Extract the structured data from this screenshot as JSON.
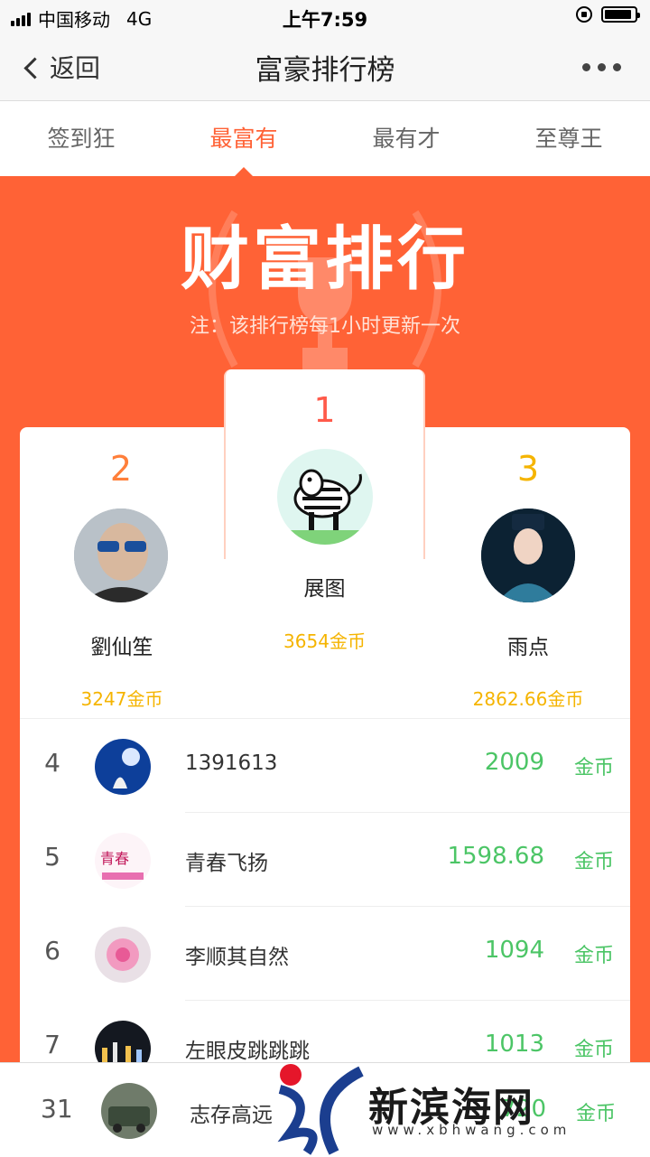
{
  "status": {
    "carrier": "中国移动",
    "network": "4G",
    "time": "上午7:59"
  },
  "nav": {
    "back_label": "返回",
    "title": "富豪排行榜"
  },
  "tabs": [
    {
      "label": "签到狂"
    },
    {
      "label": "最富有"
    },
    {
      "label": "最有才"
    },
    {
      "label": "至尊王"
    }
  ],
  "banner": {
    "title": "财富排行",
    "note": "注：该排行榜每1小时更新一次"
  },
  "podium": {
    "first": {
      "rank": "1",
      "name": "展图",
      "coins": "3654金币"
    },
    "second": {
      "rank": "2",
      "name": "劉仙笙",
      "coins": "3247金币"
    },
    "third": {
      "rank": "3",
      "name": "雨点",
      "coins": "2862.66金币"
    }
  },
  "list": [
    {
      "rank": "4",
      "name": "1391613",
      "value": "2009",
      "unit": "金币"
    },
    {
      "rank": "5",
      "name": "青春飞扬",
      "value": "1598.68",
      "unit": "金币"
    },
    {
      "rank": "6",
      "name": "李顺其自然",
      "value": "1094",
      "unit": "金币"
    },
    {
      "rank": "7",
      "name": "左眼皮跳跳跳",
      "value": "1013",
      "unit": "金币"
    }
  ],
  "me": {
    "rank": "31",
    "name": "志存高远",
    "value": "720",
    "unit": "金币"
  },
  "watermark": {
    "text": "新滨海网",
    "url": "www.xbhwang.com"
  },
  "colors": {
    "accent": "#ff6236",
    "gold": "#f5b400",
    "green": "#4cc566"
  }
}
